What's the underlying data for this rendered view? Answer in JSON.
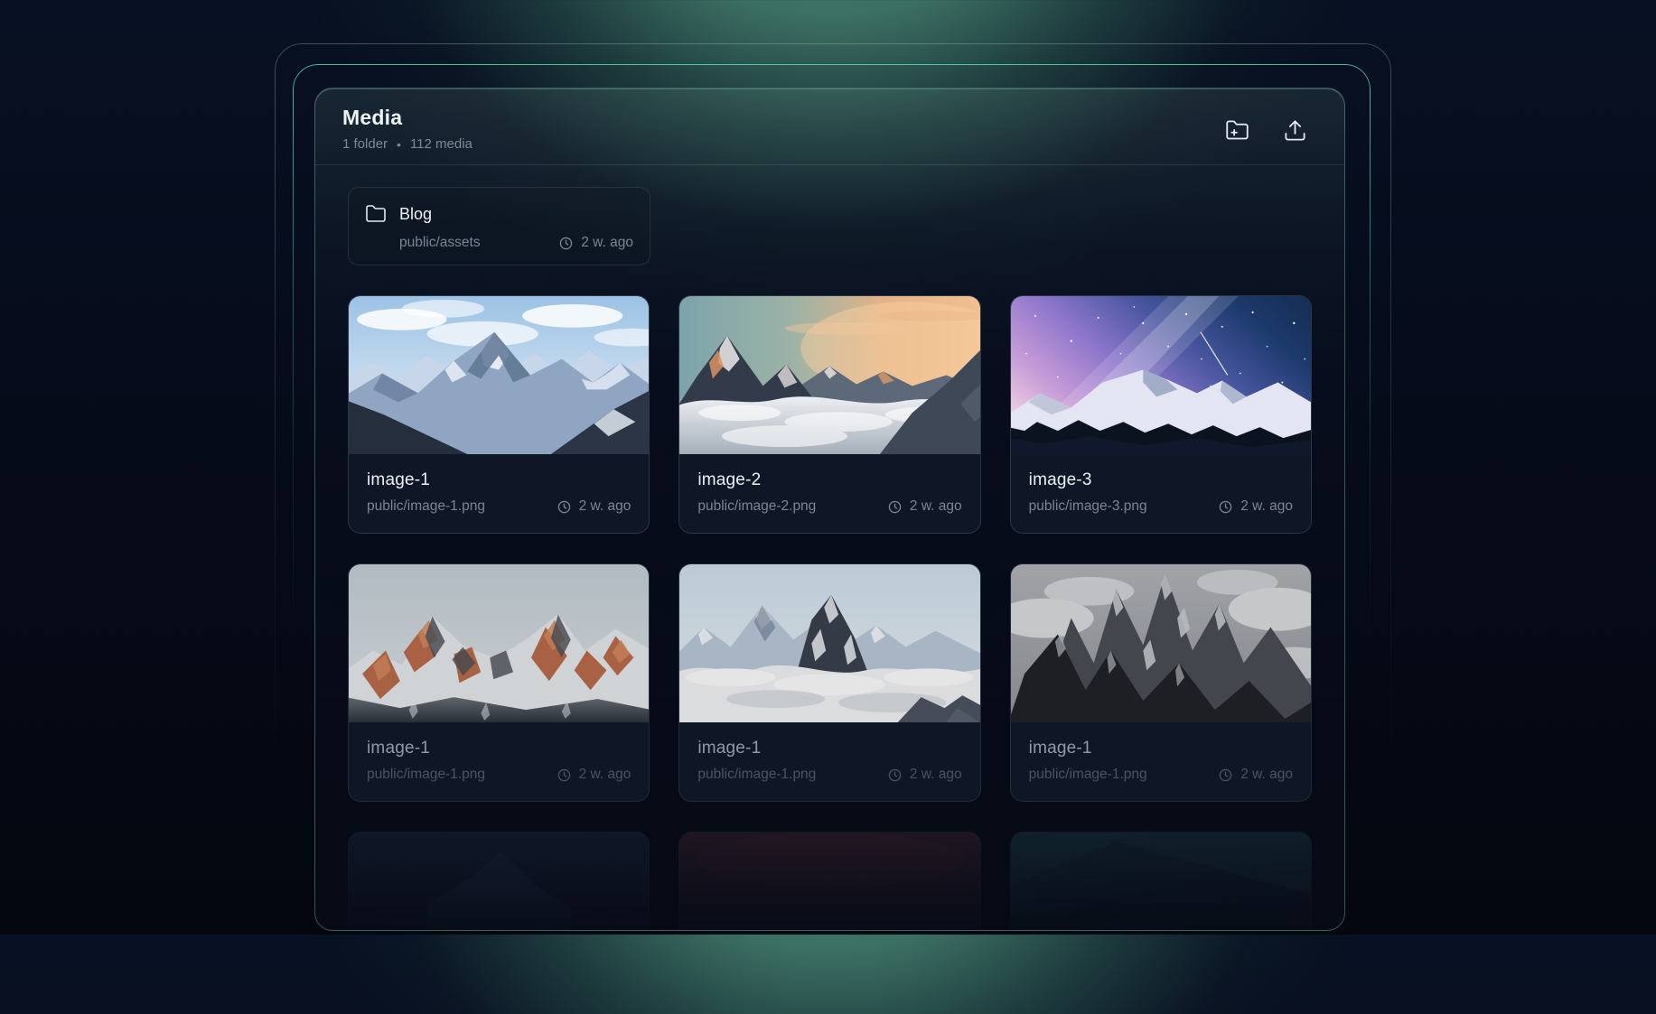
{
  "header": {
    "title": "Media",
    "stats": {
      "folders": "1 folder",
      "dot": "•",
      "media": "112 media"
    }
  },
  "icons": {
    "new_folder": "folder-plus-icon",
    "upload": "upload-icon",
    "folder": "folder-icon",
    "clock": "clock-icon"
  },
  "folder_card": {
    "name": "Blog",
    "path": "public/assets",
    "modified": "2 w. ago"
  },
  "media": [
    {
      "name": "image-1",
      "path": "public/image-1.png",
      "modified": "2 w. ago"
    },
    {
      "name": "image-2",
      "path": "public/image-2.png",
      "modified": "2 w. ago"
    },
    {
      "name": "image-3",
      "path": "public/image-3.png",
      "modified": "2 w. ago"
    },
    {
      "name": "image-1",
      "path": "public/image-1.png",
      "modified": "2 w. ago"
    },
    {
      "name": "image-1",
      "path": "public/image-1.png",
      "modified": "2 w. ago"
    },
    {
      "name": "image-1",
      "path": "public/image-1.png",
      "modified": "2 w. ago"
    }
  ],
  "colors": {
    "accent_green": "#34d399",
    "glow_teal": "#3c6f63",
    "page_bg": "#060b1a",
    "card_bg": "#0f1726",
    "title_text": "#eef4f1",
    "muted_text": "#7d8595"
  }
}
